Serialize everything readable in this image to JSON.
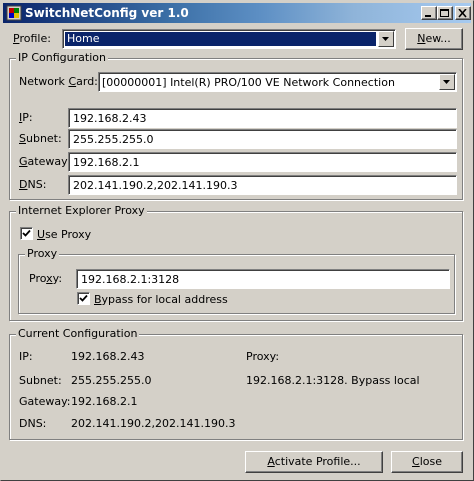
{
  "window": {
    "title": "SwitchNetConfig ver 1.0",
    "controls": {
      "minimize": "minimize-icon",
      "maximize": "maximize-icon",
      "close": "close-icon"
    }
  },
  "profile": {
    "label_first": "P",
    "label_rest": "rofile:",
    "selected": "Home",
    "new_button": "New..."
  },
  "ip_config": {
    "title": "IP Configuration",
    "network_card_label_a": "Network ",
    "network_card_label_u": "C",
    "network_card_label_b": "ard:",
    "network_card_value": "[00000001] Intel(R) PRO/100 VE Network Connection",
    "ip_label_u": "I",
    "ip_label_b": "P:",
    "ip_value": "192.168.2.43",
    "subnet_label_u": "S",
    "subnet_label_b": "ubnet:",
    "subnet_value": "255.255.255.0",
    "gateway_label_u": "G",
    "gateway_label_b": "ateway:",
    "gateway_value": "192.168.2.1",
    "dns_label_u": "D",
    "dns_label_b": "NS:",
    "dns_value": "202.141.190.2,202.141.190.3"
  },
  "ie_proxy": {
    "title": "Internet Explorer Proxy",
    "use_proxy_u": "U",
    "use_proxy_b": "se Proxy",
    "use_proxy_checked": true,
    "proxy_group_title": "Proxy",
    "proxy_label_a": "Pro",
    "proxy_label_u": "x",
    "proxy_label_b": "y:",
    "proxy_value": "192.168.2.1:3128",
    "bypass_u": "B",
    "bypass_b": "ypass for local address",
    "bypass_checked": true
  },
  "current": {
    "title": "Current Configuration",
    "ip_label": "IP:",
    "ip_value": "192.168.2.43",
    "subnet_label": "Subnet:",
    "subnet_value": "255.255.255.0",
    "gateway_label": "Gateway:",
    "gateway_value": "192.168.2.1",
    "dns_label": "DNS:",
    "dns_value": "202.141.190.2,202.141.190.3",
    "proxy_label": "Proxy:",
    "proxy_value": "192.168.2.1:3128. Bypass local"
  },
  "buttons": {
    "activate_u": "A",
    "activate_b": "ctivate Profile...",
    "close_u": "C",
    "close_b": "lose"
  },
  "colors": {
    "face": "#d4d0c8",
    "title_start": "#0a246a",
    "title_end": "#a6caf0",
    "selection": "#0a246a"
  }
}
